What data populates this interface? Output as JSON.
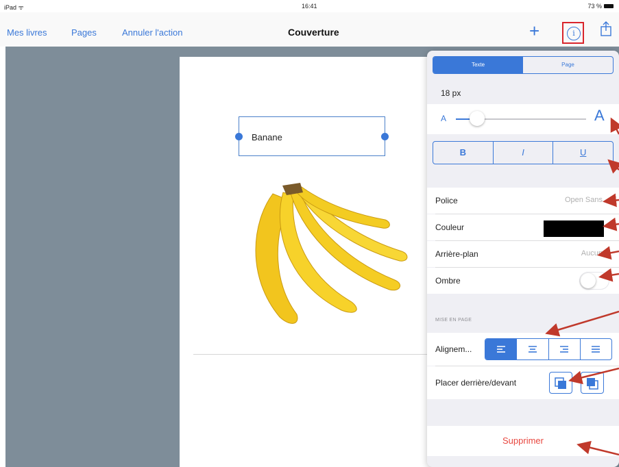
{
  "status_bar": {
    "device": "iPad ᯤ",
    "time": "16:41",
    "battery": "73 %"
  },
  "navbar": {
    "links": [
      "Mes livres",
      "Pages",
      "Annuler l'action"
    ],
    "title": "Couverture",
    "plus_icon": "+",
    "info_icon": "i"
  },
  "page": {
    "text_box_value": "Banane"
  },
  "panel": {
    "tabs": [
      {
        "label": "Texte",
        "active": true
      },
      {
        "label": "Page",
        "active": false
      }
    ],
    "font_size": "18 px",
    "slider": {
      "small_a": "A",
      "big_a": "A",
      "value_fraction": 0.1
    },
    "style_buttons": [
      "B",
      "I",
      "U"
    ],
    "rows": {
      "police": {
        "label": "Police",
        "value": "Open Sans"
      },
      "couleur": {
        "label": "Couleur",
        "color": "#000000"
      },
      "arriere_plan": {
        "label": "Arrière-plan",
        "value": "Aucun"
      },
      "ombre": {
        "label": "Ombre",
        "on": false
      }
    },
    "section_header": "MISE EN PAGE",
    "alignment": {
      "label": "Alignem...",
      "options": [
        "left",
        "center",
        "right",
        "justify"
      ],
      "selected": "left"
    },
    "layer": {
      "label": "Placer derrière/devant"
    },
    "delete_label": "Supprimer"
  },
  "colors": {
    "accent": "#3a78d8",
    "annotation_arrow": "#c0392b",
    "delete": "#e8473f",
    "highlight_box": "#d9242b",
    "canvas": "#7e8d99"
  }
}
